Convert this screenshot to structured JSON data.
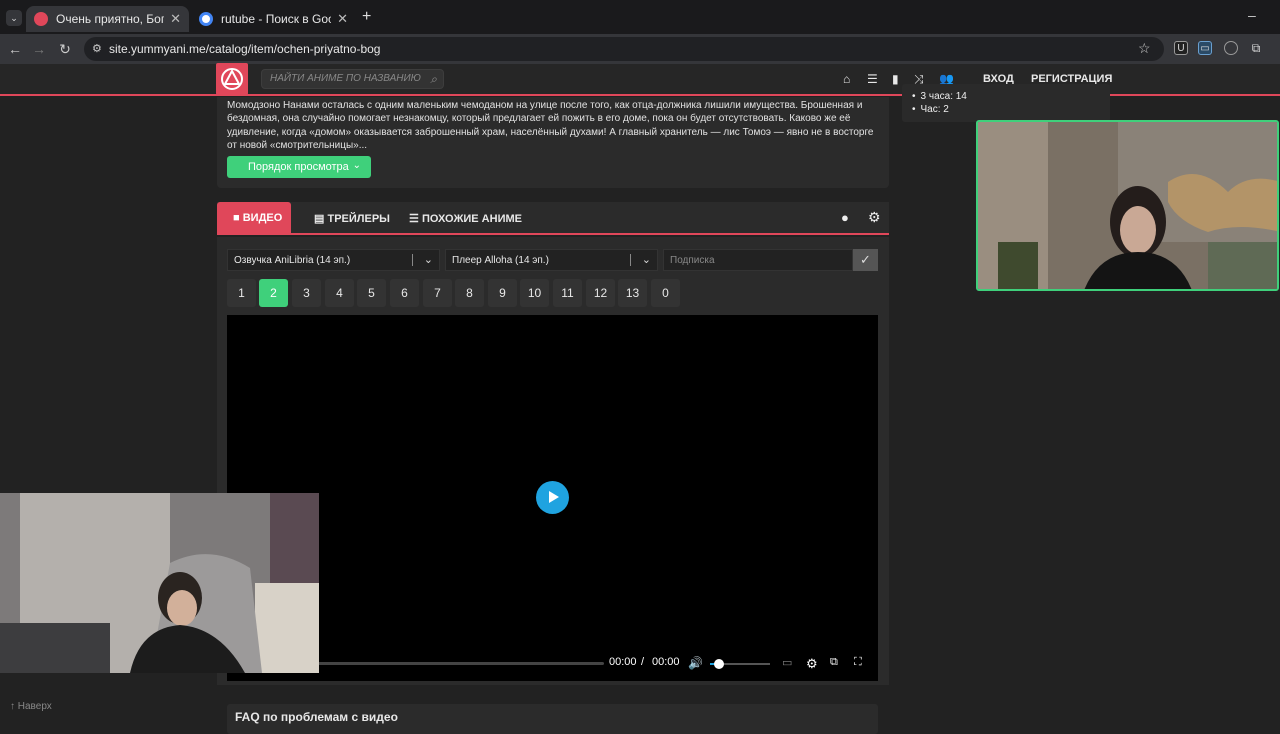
{
  "browser": {
    "tabs": [
      {
        "title": "Очень приятно, Бог — смотреть",
        "active": true,
        "favicon_color": "#e0475a"
      },
      {
        "title": "rutube - Поиск в Google",
        "active": false,
        "favicon_color": "#4285f4"
      }
    ],
    "new_tab": "+",
    "url": "site.yummyani.me/catalog/item/ochen-priyatno-bog"
  },
  "site": {
    "search_placeholder": "НАЙТИ АНИМЕ ПО НАЗВАНИЮ",
    "login": "ВХОД",
    "register": "РЕГИСТРАЦИЯ",
    "description": "Момодзоно Нанами осталась с одним маленьким чемоданом на улице после того, как отца-должника лишили имущества. Брошенная и бездомная, она случайно помогает незнакомцу, который предлагает ей пожить в его доме, пока он будет отсутствовать. Каково же её удивление, когда «домом» оказывается заброшенный храм, населённый духами! А главный хранитель — лис Томоэ — явно не в восторге от новой «смотрительницы»...",
    "watch_order_button": "Порядок просмотра",
    "tabs": {
      "video": "ВИДЕО",
      "trailers": "ТРЕЙЛЕРЫ",
      "similar": "ПОХОЖИЕ АНИМЕ"
    },
    "dub_select": "Озвучка AniLibria (14 эп.)",
    "player_select": "Плеер Alloha (14 эп.)",
    "subscribe_placeholder": "Подписка",
    "episodes": [
      "1",
      "2",
      "3",
      "4",
      "5",
      "6",
      "7",
      "8",
      "9",
      "10",
      "11",
      "12",
      "13",
      "0"
    ],
    "active_episode": "2",
    "player": {
      "current_time": "00:00",
      "separator": "/",
      "duration": "00:00",
      "volume": 0.15
    },
    "faq_title": "FAQ по проблемам с видео",
    "back_to_top": "↑ Наверх"
  },
  "overlay": {
    "items": [
      "3 часа: 14",
      "Час: 2"
    ]
  },
  "colors": {
    "accent": "#e0475a",
    "green": "#3fd07b",
    "play": "#1fa3e0"
  }
}
